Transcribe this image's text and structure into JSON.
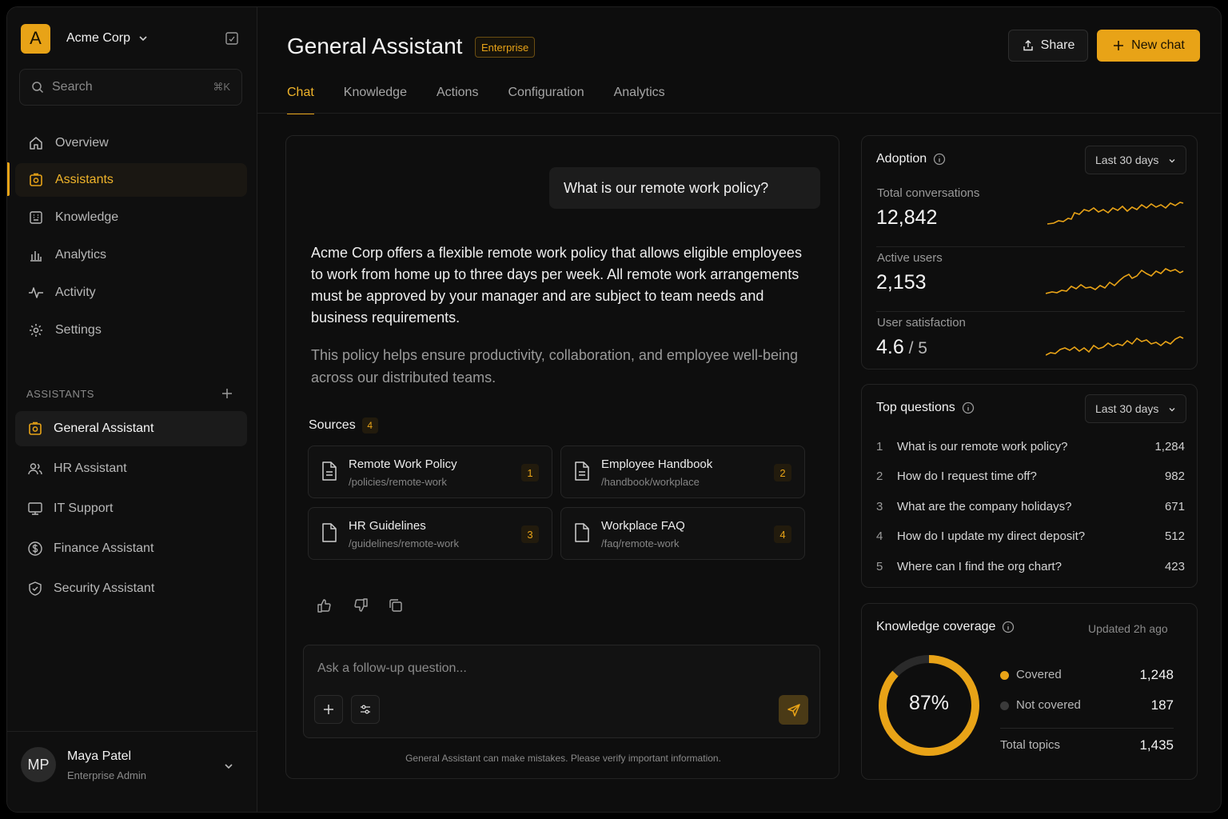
{
  "org": {
    "logo_letter": "A",
    "name": "Acme Corp"
  },
  "search": {
    "placeholder": "Search",
    "shortcut": "⌘K"
  },
  "nav": [
    {
      "label": "Overview",
      "icon": "home-icon"
    },
    {
      "label": "Assistants",
      "icon": "assistant-icon",
      "active": true
    },
    {
      "label": "Knowledge",
      "icon": "knowledge-icon"
    },
    {
      "label": "Analytics",
      "icon": "bar-chart-icon"
    },
    {
      "label": "Activity",
      "icon": "pulse-icon"
    },
    {
      "label": "Settings",
      "icon": "gear-icon"
    }
  ],
  "assistants_section": {
    "label": "ASSISTANTS",
    "items": [
      {
        "label": "General Assistant",
        "icon": "assistant-icon",
        "active": true
      },
      {
        "label": "HR Assistant",
        "icon": "users-icon"
      },
      {
        "label": "IT Support",
        "icon": "monitor-icon"
      },
      {
        "label": "Finance Assistant",
        "icon": "dollar-icon"
      },
      {
        "label": "Security Assistant",
        "icon": "shield-icon"
      }
    ]
  },
  "user": {
    "initials": "MP",
    "name": "Maya Patel",
    "role": "Enterprise Admin"
  },
  "header": {
    "title": "General Assistant",
    "badge": "Enterprise",
    "share_label": "Share",
    "new_chat_label": "New chat"
  },
  "tabs": [
    {
      "label": "Chat",
      "active": true
    },
    {
      "label": "Knowledge"
    },
    {
      "label": "Actions"
    },
    {
      "label": "Configuration"
    },
    {
      "label": "Analytics"
    }
  ],
  "chat": {
    "user_message": "What is our remote work policy?",
    "answer_p1": "Acme Corp offers a flexible remote work policy that allows eligible employees to work from home up to three days per week. All remote work arrangements must be approved by your manager and are subject to team needs and business requirements.",
    "answer_p2": "This policy helps ensure productivity, collaboration, and employee well-being across our distributed teams.",
    "sources_label": "Sources",
    "sources_count": "4",
    "sources": [
      {
        "title": "Remote Work Policy",
        "path": "/policies/remote-work",
        "num": "1"
      },
      {
        "title": "Employee Handbook",
        "path": "/handbook/workplace",
        "num": "2"
      },
      {
        "title": "HR Guidelines",
        "path": "/guidelines/remote-work",
        "num": "3"
      },
      {
        "title": "Workplace FAQ",
        "path": "/faq/remote-work",
        "num": "4"
      }
    ],
    "composer_placeholder": "Ask a follow-up question...",
    "disclaimer": "General Assistant can make mistakes. Please verify important information."
  },
  "adoption": {
    "title": "Adoption",
    "range": "Last 30 days",
    "metrics": [
      {
        "label": "Total conversations",
        "value": "12,842",
        "suffix": ""
      },
      {
        "label": "Active users",
        "value": "2,153",
        "suffix": ""
      },
      {
        "label": "User satisfaction",
        "value": "4.6",
        "suffix": " / 5"
      }
    ]
  },
  "top_questions": {
    "title": "Top questions",
    "range": "Last 30 days",
    "items": [
      {
        "rank": "1",
        "text": "What is our remote work policy?",
        "count": "1,284"
      },
      {
        "rank": "2",
        "text": "How do I request time off?",
        "count": "982"
      },
      {
        "rank": "3",
        "text": "What are the company holidays?",
        "count": "671"
      },
      {
        "rank": "4",
        "text": "How do I update my direct deposit?",
        "count": "512"
      },
      {
        "rank": "5",
        "text": "Where can I find the org chart?",
        "count": "423"
      }
    ]
  },
  "coverage": {
    "title": "Knowledge coverage",
    "updated": "Updated 2h ago",
    "percent_label": "87%",
    "percent": 0.87,
    "covered_label": "Covered",
    "covered_value": "1,248",
    "not_covered_label": "Not covered",
    "not_covered_value": "187",
    "total_label": "Total topics",
    "total_value": "1,435"
  },
  "colors": {
    "accent": "#e8a317",
    "not_covered": "#3a3a3a"
  }
}
